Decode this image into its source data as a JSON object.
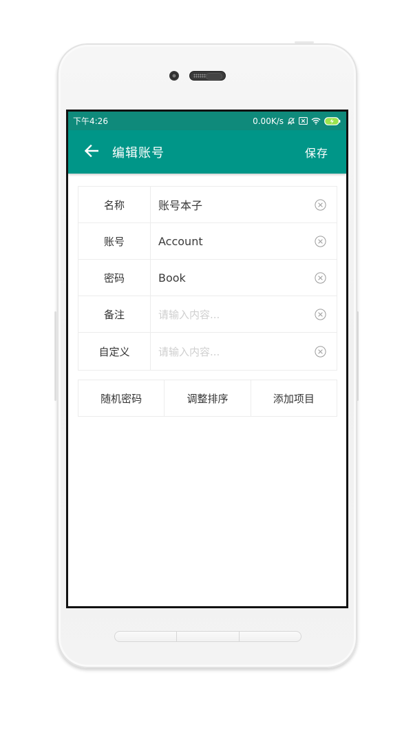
{
  "status_bar": {
    "time": "下午4:26",
    "network_speed": "0.00K/s",
    "icons": [
      "mute-icon",
      "sim-icon",
      "wifi-icon",
      "battery-charging-icon"
    ]
  },
  "app_bar": {
    "back_icon": "arrow-left-icon",
    "title": "编辑账号",
    "save_label": "保存"
  },
  "form": {
    "rows": [
      {
        "label": "名称",
        "value": "账号本子",
        "placeholder": "请输入内容..."
      },
      {
        "label": "账号",
        "value": "Account",
        "placeholder": "请输入内容..."
      },
      {
        "label": "密码",
        "value": "Book",
        "placeholder": "请输入内容..."
      },
      {
        "label": "备注",
        "value": "",
        "placeholder": "请输入内容..."
      },
      {
        "label": "自定义",
        "value": "",
        "placeholder": "请输入内容..."
      }
    ],
    "clear_icon": "clear-circle-icon"
  },
  "actions": [
    {
      "label": "随机密码"
    },
    {
      "label": "调整排序"
    },
    {
      "label": "添加项目"
    }
  ],
  "colors": {
    "primary": "#009688",
    "status_bar": "#0f8a7b",
    "border": "#ececec"
  }
}
